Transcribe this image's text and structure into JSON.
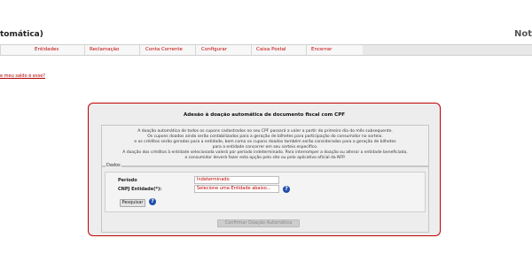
{
  "header": {
    "title": "tomática)",
    "right_text": "Not"
  },
  "nav": {
    "items": [
      "Entidades",
      "Reclamação",
      "Conta Corrente",
      "Configurar",
      "Caixa Postal",
      "Encerrar"
    ]
  },
  "saldo_link": "e meu saldo é esse?",
  "panel": {
    "title": "Adesão à doação automática de documento fiscal com CPF",
    "info_lines": [
      "A doação automática de todos os cupons cadastrados no seu CPF passará a valer a partir do primeiro dia do mês subsequente.",
      "Os cupons doados ainda serão contabilizados para a geração de bilhetes para participação do consumidor no sorteio.",
      "e os créditos serão gerados para a entidade, bem como os cupons doados também serão considerados para a geração de bilhetes",
      "para a entidade concorrer em seu sorteio específico.",
      "A doação dos créditos à entidade selecionada valerá por período indeterminado. Para interromper a doação ou alterar a entidade beneficiada,",
      "o consumidor deverá fazer esta opção pelo site ou pelo aplicativo oficial da NFP."
    ],
    "legend": "Dados",
    "periodo_label": "Período",
    "periodo_value": "Indeterminado",
    "cnpj_label": "CNPJ Entidade(*):",
    "cnpj_value": "Selecione uma Entidade abaixo...",
    "help_glyph": "?",
    "search_button": "Pesquisar",
    "confirm_button": "Confirmar Doação Automática"
  }
}
